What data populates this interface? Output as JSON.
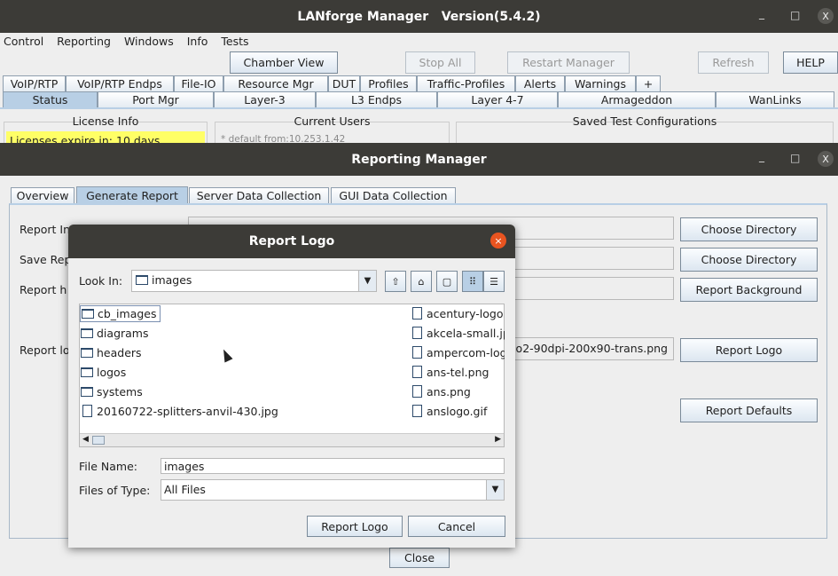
{
  "main_window": {
    "title": "LANforge Manager   Version(5.4.2)",
    "controls": [
      "_",
      "□",
      "X"
    ]
  },
  "menu": [
    "Control",
    "Reporting",
    "Windows",
    "Info",
    "Tests"
  ],
  "toolbar": {
    "chamber_view": "Chamber View",
    "stop_all": "Stop All",
    "restart_manager": "Restart Manager",
    "refresh": "Refresh",
    "help": "HELP"
  },
  "tabs_row1": [
    "VoIP/RTP",
    "VoIP/RTP Endps",
    "File-IO",
    "Resource Mgr",
    "DUT",
    "Profiles",
    "Traffic-Profiles",
    "Alerts",
    "Warnings",
    "+"
  ],
  "tabs_row2": [
    "Status",
    "Port Mgr",
    "Layer-3",
    "L3 Endps",
    "Layer 4-7",
    "Armageddon",
    "WanLinks"
  ],
  "status": {
    "license_title": "License Info",
    "license_text": "Licenses expire in: 10 days",
    "users_title": "Current Users",
    "users_text": "* default from:10.253.1.42",
    "saved_title": "Saved Test Configurations"
  },
  "reporting": {
    "title": "Reporting Manager",
    "tabs": [
      "Overview",
      "Generate Report",
      "Server Data Collection",
      "GUI Data Collection"
    ],
    "labels": [
      "Report In",
      "Save Rep",
      "Report h",
      "Report lo"
    ],
    "logo_field": "go2-90dpi-200x90-trans.png",
    "buttons": {
      "choose_dir1": "Choose Directory",
      "choose_dir2": "Choose Directory",
      "background": "Report Background",
      "logo": "Report Logo",
      "defaults": "Report Defaults"
    },
    "close": "Close"
  },
  "dialog": {
    "title": "Report Logo",
    "look_in_label": "Look In:",
    "look_in_value": "images",
    "folders": [
      "cb_images",
      "diagrams",
      "headers",
      "logos",
      "systems"
    ],
    "left_files": [
      "20160722-splitters-anvil-430.jpg"
    ],
    "right_files": [
      "acentury-logo",
      "akcela-small.jp",
      "ampercom-log",
      "ans-tel.png",
      "ans.png",
      "anslogo.gif"
    ],
    "file_name_label": "File Name:",
    "file_name_value": "images",
    "files_of_type_label": "Files of Type:",
    "files_of_type_value": "All Files",
    "approve": "Report Logo",
    "cancel": "Cancel"
  },
  "colors": {
    "title_bar": "#3c3b37",
    "license_highlight": "#ffff66",
    "dialog_close": "#e95420",
    "selected_tab": "#b8cfe5"
  }
}
